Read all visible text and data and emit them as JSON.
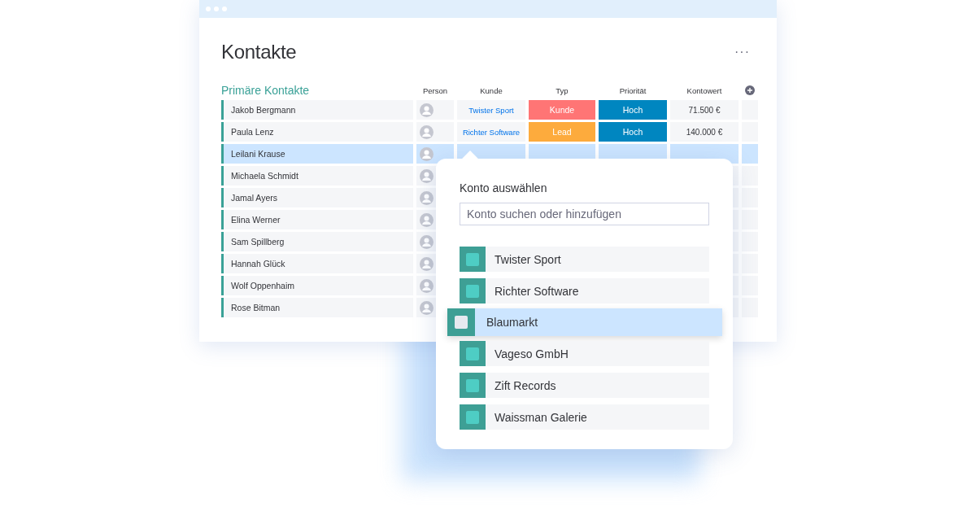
{
  "title": "Kontakte",
  "menu_icon_label": "···",
  "table": {
    "group_title": "Primäre Kontakte",
    "columns": [
      "Person",
      "Kunde",
      "Typ",
      "Priorität",
      "Kontowert"
    ],
    "rows": [
      {
        "name": "Jakob Bergmann",
        "customer": "Twister Sport",
        "type": {
          "label": "Kunde",
          "color": "#ff7575"
        },
        "priority": {
          "label": "Hoch",
          "color": "#0086c0"
        },
        "value": "71.500 €",
        "selected": false
      },
      {
        "name": "Paula Lenz",
        "customer": "Richter Software",
        "type": {
          "label": "Lead",
          "color": "#fdab3d"
        },
        "priority": {
          "label": "Hoch",
          "color": "#0086c0"
        },
        "value": "140.000 €",
        "selected": false
      },
      {
        "name": "Leilani Krause",
        "selected": true
      },
      {
        "name": "Michaela Schmidt",
        "selected": false
      },
      {
        "name": "Jamal Ayers",
        "selected": false
      },
      {
        "name": "Elina Werner",
        "selected": false
      },
      {
        "name": "Sam Spillberg",
        "selected": false
      },
      {
        "name": "Hannah Glück",
        "selected": false
      },
      {
        "name": "Wolf Oppenhaim",
        "selected": false
      },
      {
        "name": "Rose Bitman",
        "selected": false
      }
    ]
  },
  "popup": {
    "title": "Konto auswählen",
    "search": {
      "placeholder": "Konto suchen oder hinzufügen"
    },
    "items": [
      {
        "label": "Twister Sport",
        "selected": false
      },
      {
        "label": "Richter Software",
        "selected": false
      },
      {
        "label": "Blaumarkt",
        "selected": true
      },
      {
        "label": "Vageso GmbH",
        "selected": false
      },
      {
        "label": "Zift Records",
        "selected": false
      },
      {
        "label": "Waissman Galerie",
        "selected": false
      }
    ]
  }
}
